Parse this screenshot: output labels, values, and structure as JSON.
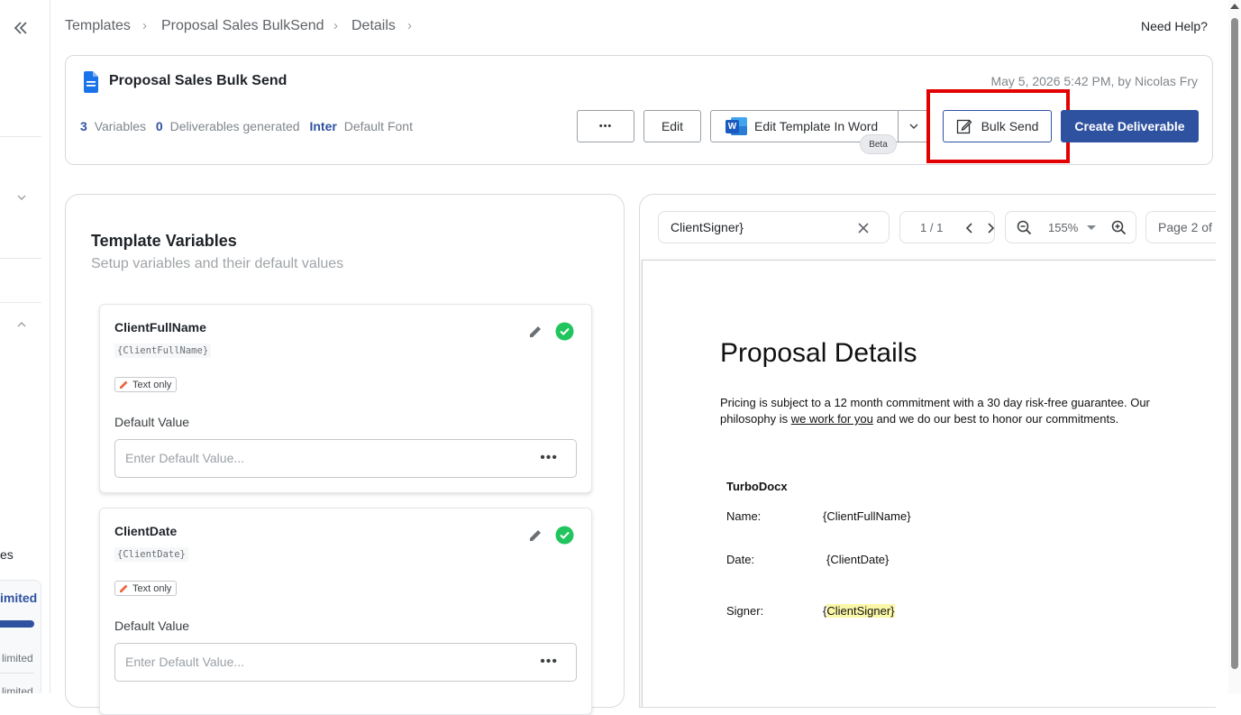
{
  "sidebar": {
    "collapse_icon": "double-chevron-left-icon",
    "partial_text_1": "es",
    "partial_text_2": "imited",
    "partial_text_3": "limited",
    "partial_text_4": "limited"
  },
  "breadcrumb": [
    "Templates",
    "Proposal Sales BulkSend",
    "Details"
  ],
  "help_label": "Need Help?",
  "template": {
    "title": "Proposal Sales Bulk Send",
    "meta": "May 5, 2026 5:42 PM, by Nicolas Fry",
    "variables_count": "3",
    "variables_label": "Variables",
    "deliverables_count": "0",
    "deliverables_label": "Deliverables generated",
    "font_name": "Inter",
    "font_label": "Default Font"
  },
  "actions": {
    "more_label": "•••",
    "edit_label": "Edit",
    "word_label": "Edit Template In Word",
    "word_icon_letter": "W",
    "beta_label": "Beta",
    "bulk_send_label": "Bulk Send",
    "create_label": "Create Deliverable"
  },
  "colors": {
    "primary": "#2f52a0",
    "highlight_box": "#e30000",
    "success": "#21c55d",
    "word_blue": "#185abd"
  },
  "variables_panel": {
    "title": "Template Variables",
    "subtitle": "Setup variables and their default values",
    "items": [
      {
        "name": "ClientFullName",
        "tag": "{ClientFullName}",
        "type": "Text only",
        "default_label": "Default Value",
        "placeholder": "Enter Default Value..."
      },
      {
        "name": "ClientDate",
        "tag": "{ClientDate}",
        "type": "Text only",
        "default_label": "Default Value",
        "placeholder": "Enter Default Value..."
      }
    ]
  },
  "preview": {
    "search_value": "ClientSigner}",
    "match_count": "1 / 1",
    "zoom": "155%",
    "page_label": "Page 2 of",
    "doc": {
      "heading": "Proposal Details",
      "para_line1": "Pricing is subject to a 12 month commitment with a 30 day risk-free guarantee. Our",
      "para_line2_pre": "philosophy is ",
      "para_line2_link": "we work for you",
      "para_line2_post": " and we do our best to honor our commitments.",
      "company": "TurboDocx",
      "rows": [
        {
          "label": "Name:",
          "value": "{ClientFullName}"
        },
        {
          "label": "Date:",
          "value": "{ClientDate}"
        },
        {
          "label": "Signer:",
          "value_pre": "{",
          "value_hl": "ClientSigner}"
        }
      ]
    }
  }
}
